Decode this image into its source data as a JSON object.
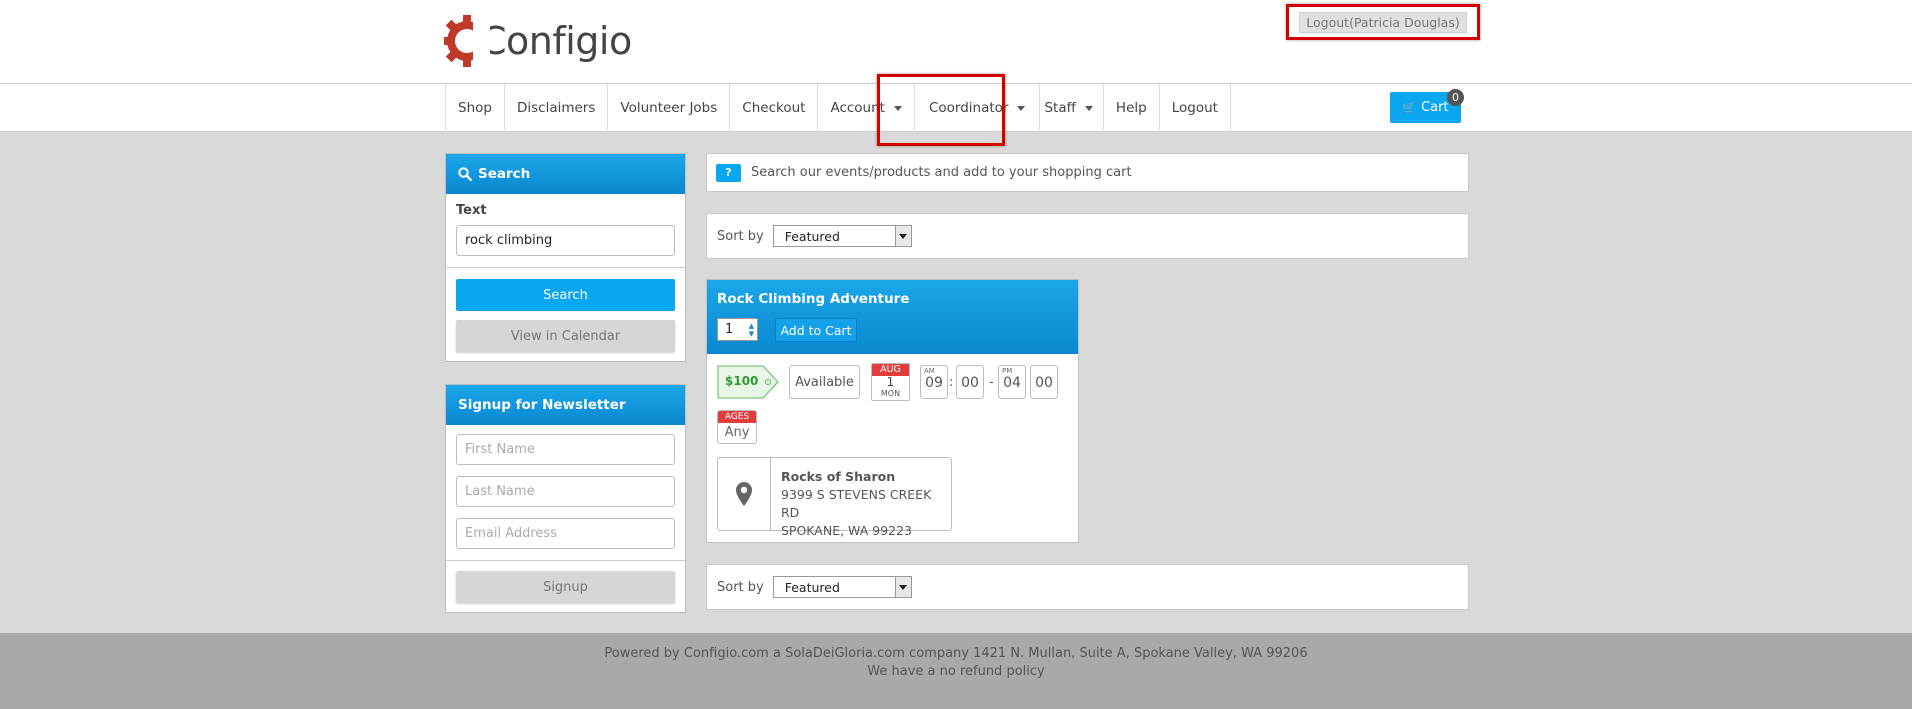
{
  "header": {
    "logo_text": "Configio",
    "logout_label": "Logout(Patricia Douglas)"
  },
  "nav": {
    "items": [
      {
        "label": "Shop",
        "dropdown": false
      },
      {
        "label": "Disclaimers",
        "dropdown": false
      },
      {
        "label": "Volunteer Jobs",
        "dropdown": false
      },
      {
        "label": "Checkout",
        "dropdown": false
      },
      {
        "label": "Account",
        "dropdown": true
      },
      {
        "label": "Coordinator",
        "dropdown": true
      },
      {
        "label": "Staff",
        "dropdown": true
      },
      {
        "label": "Help",
        "dropdown": false
      },
      {
        "label": "Logout",
        "dropdown": false
      }
    ],
    "cart_label": "Cart",
    "cart_count": "0",
    "cart_icon": "cart-icon"
  },
  "search": {
    "title": "Search",
    "text_label": "Text",
    "text_value": "rock climbing",
    "search_button": "Search",
    "calendar_button": "View in Calendar"
  },
  "newsletter": {
    "title": "Signup for Newsletter",
    "first_name_placeholder": "First Name",
    "last_name_placeholder": "Last Name",
    "email_placeholder": "Email Address",
    "signup_button": "Signup"
  },
  "main": {
    "help_badge": "?",
    "help_text": "Search our events/products and add to your shopping cart",
    "sort_label": "Sort by",
    "sort_value": "Featured"
  },
  "product": {
    "title": "Rock Climbing Adventure",
    "quantity": "1",
    "add_to_cart": "Add to Cart",
    "price": "$100",
    "availability": "Available",
    "date": {
      "month": "AUG",
      "day": "1",
      "weekday": "MON"
    },
    "start_time": {
      "meridiem": "AM",
      "hour": "09",
      "minute": "00"
    },
    "end_time": {
      "meridiem": "PM",
      "hour": "04",
      "minute": "00"
    },
    "ages_label": "AGES",
    "ages_value": "Any",
    "location": {
      "name": "Rocks of Sharon",
      "address1": "9399 S STEVENS CREEK RD",
      "address2": "SPOKANE, WA 99223"
    }
  },
  "footer": {
    "line1": "Powered by Configio.com a SolaDeiGloria.com company 1421 N. Mullan, Suite A, Spokane Valley, WA 99206",
    "line2": "We have a no refund policy"
  },
  "colors": {
    "primary": "#0aa6ef",
    "highlight": "#d40000",
    "badge_red": "#e23c3c",
    "price_green": "#2e9b2e"
  }
}
